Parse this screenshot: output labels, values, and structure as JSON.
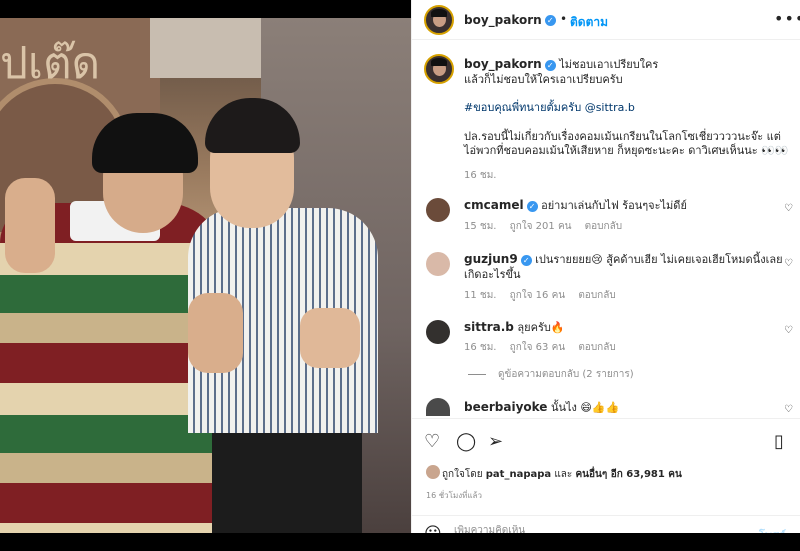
{
  "post": {
    "username": "boy_pakorn",
    "separator": "•",
    "follow_label": "ติดตาม",
    "more_label": "•••"
  },
  "caption": {
    "username": "boy_pakorn",
    "line1": "ไม่ชอบเอาเปรียบใคร",
    "line2": "แล้วก็ไม่ชอบให้ใครเอาเปรียบครับ",
    "hashtag": "#ขอบคุณพี่ทนายตั้มครับ",
    "mention": "@sittra.b",
    "line4": "ปล.รอบนี้ไม่เกี่ยวกับเรื่องคอมเม้นเกรียนในโลกโซเชี่ยววววนะจ๊ะ แต่ไอ่พวกที่ชอบคอมเม้นให้เสียหาย ก็หยุดซะนะคะ ดาวิเศษเห็นนะ 👀👀",
    "time": "16 ชม."
  },
  "comments": [
    {
      "username": "cmcamel",
      "verified": true,
      "text": "อย่ามาเล่นกับไฟ ร้อนๆจะไม่ดีย์",
      "time": "15 ชม.",
      "likes": "ถูกใจ 201 คน",
      "reply": "ตอบกลับ"
    },
    {
      "username": "guzjun9",
      "verified": true,
      "text": "เปนรายยยย😢 สู้คด้าบเฮีย ไม่เคยเจอเฮียโหมดนี้งเลย เกิดอะไรขึ้น",
      "time": "11 ชม.",
      "likes": "ถูกใจ 16 คน",
      "reply": "ตอบกลับ"
    },
    {
      "username": "sittra.b",
      "verified": false,
      "text": "ลุยครับ🔥",
      "time": "16 ชม.",
      "likes": "ถูกใจ 63 คน",
      "reply": "ตอบกลับ"
    },
    {
      "username": "beerbaiyoke",
      "verified": false,
      "text": "นั้นไง 😄👍👍"
    }
  ],
  "replies_link": "ดูข้อความตอบกลับ (2 รายการ)",
  "likes": {
    "prefix": "ถูกใจโดย",
    "user": "pat_napapa",
    "and": "และ",
    "others": "คนอื่นๆ อีก 63,981 คน"
  },
  "posted_ago": "16 ชั่วโมงที่แล้ว",
  "composer": {
    "placeholder": "เพิ่มความคิดเห็น",
    "post_label": "โพสต์"
  },
  "icons": {
    "verified": "✓",
    "heart": "♡",
    "comment": "◯",
    "share": "➢",
    "save": "▯",
    "emoji": "☺"
  },
  "colors": {
    "link_blue": "#0095f6",
    "verified_blue": "#3897f0",
    "muted": "#8e8e8e"
  },
  "photo_sign": "ปเต๊ด"
}
